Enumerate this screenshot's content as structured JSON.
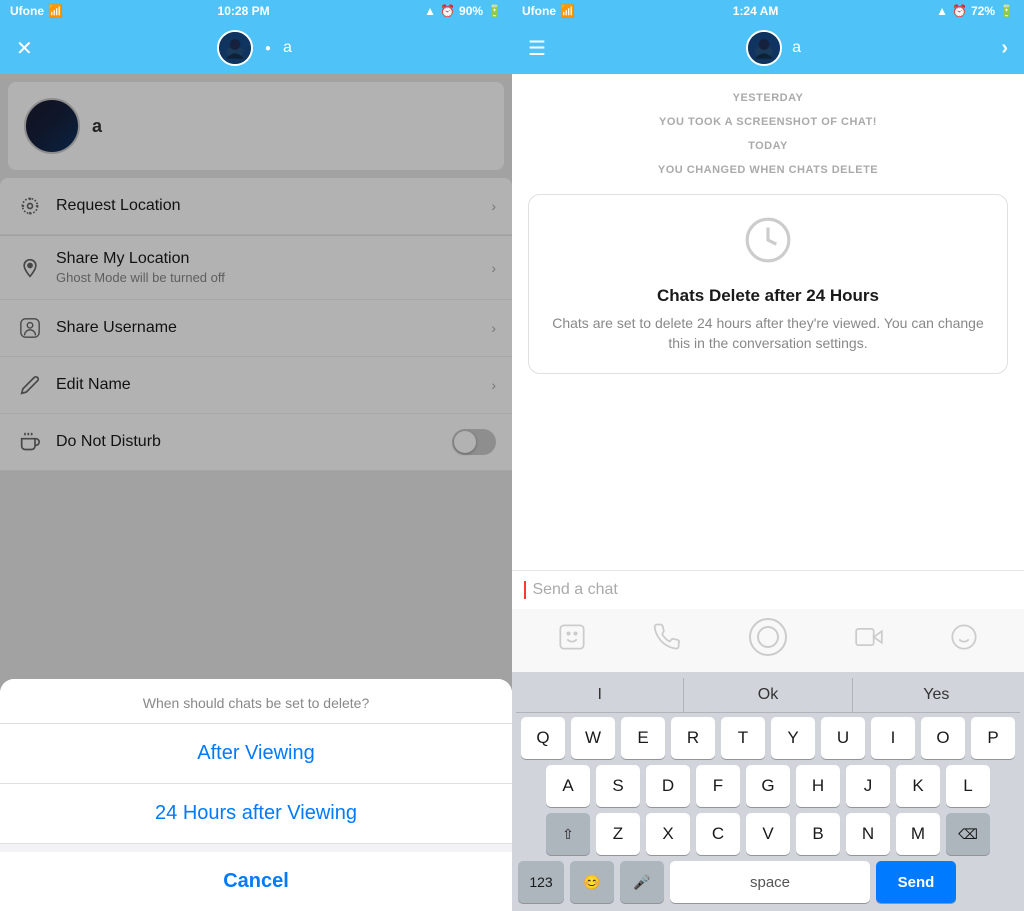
{
  "left": {
    "statusBar": {
      "carrier": "Ufone",
      "wifi": "WiFi",
      "time": "10:28 PM",
      "battery": "90%"
    },
    "nav": {
      "closeLabel": "✕",
      "usernameLabel": "a"
    },
    "profile": {
      "name": "a"
    },
    "menuItems": [
      {
        "icon": "📍",
        "title": "Request Location",
        "subtitle": "",
        "hasChevron": true,
        "hasToggle": false
      },
      {
        "icon": "📍",
        "title": "Share My Location",
        "subtitle": "Ghost Mode will be turned off",
        "hasChevron": true,
        "hasToggle": false
      },
      {
        "icon": "👻",
        "title": "Share Username",
        "subtitle": "",
        "hasChevron": true,
        "hasToggle": false
      },
      {
        "icon": "✏️",
        "title": "Edit Name",
        "subtitle": "",
        "hasChevron": true,
        "hasToggle": false
      },
      {
        "icon": "💤",
        "title": "Do Not Disturb",
        "subtitle": "",
        "hasChevron": false,
        "hasToggle": true
      }
    ],
    "actionSheet": {
      "title": "When should chats be set to delete?",
      "options": [
        "After Viewing",
        "24 Hours after Viewing"
      ],
      "cancelLabel": "Cancel"
    }
  },
  "right": {
    "statusBar": {
      "carrier": "Ufone",
      "wifi": "WiFi",
      "time": "1:24 AM",
      "battery": "72%"
    },
    "nav": {
      "usernameLabel": "a"
    },
    "chat": {
      "systemMessages": [
        "YESTERDAY",
        "YOU TOOK A SCREENSHOT OF CHAT!",
        "TODAY",
        "YOU CHANGED WHEN CHATS DELETE"
      ],
      "card": {
        "title": "Chats Delete after 24 Hours",
        "description": "Chats are set to delete 24 hours after they're viewed. You can change this in the conversation settings."
      }
    },
    "inputBar": {
      "placeholder": "Send a chat"
    },
    "keyboard": {
      "suggestions": [
        "I",
        "Ok",
        "Yes"
      ],
      "rows": [
        [
          "Q",
          "W",
          "E",
          "R",
          "T",
          "Y",
          "U",
          "I",
          "O",
          "P"
        ],
        [
          "A",
          "S",
          "D",
          "F",
          "G",
          "H",
          "J",
          "K",
          "L"
        ],
        [
          "⇧",
          "Z",
          "X",
          "C",
          "V",
          "B",
          "N",
          "M",
          "⌫"
        ],
        [
          "123",
          "😊",
          "🎤",
          "space",
          "Send"
        ]
      ]
    }
  }
}
